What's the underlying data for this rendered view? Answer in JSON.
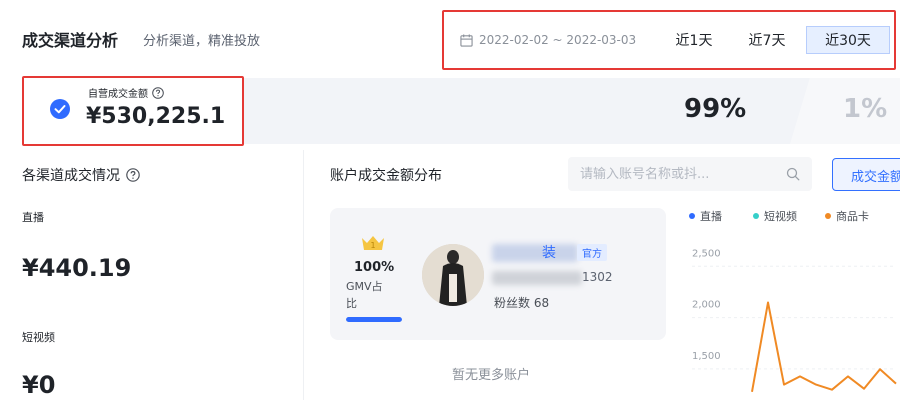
{
  "header": {
    "title": "成交渠道分析",
    "subtitle": "分析渠道，精准投放"
  },
  "date_filter": {
    "range": "2022-02-02 ~ 2022-03-03",
    "tabs": [
      {
        "label": "近1天",
        "selected": false
      },
      {
        "label": "近7天",
        "selected": false
      },
      {
        "label": "近30天",
        "selected": true
      }
    ]
  },
  "summary": {
    "self_label": "自营成交金额",
    "self_value": "¥530,225.1",
    "self_share": "99%",
    "other_share": "1%"
  },
  "channels": {
    "title": "各渠道成交情况",
    "items": [
      {
        "label": "直播",
        "value": "¥440.19"
      },
      {
        "label": "短视频",
        "value": "¥0"
      }
    ]
  },
  "accounts": {
    "title": "账户成交金额分布",
    "search_placeholder": "请输入账号名称或抖...",
    "metric_button": "成交金额",
    "card": {
      "gmv_percent": "100%",
      "gmv_label": "GMV占比",
      "gmv_share": 1.0,
      "name_visible": "装",
      "badge": "官方",
      "id_visible": "1302",
      "fans": "粉丝数 68"
    },
    "no_more": "暂无更多账户"
  },
  "colors": {
    "accent": "#2f6bff",
    "highlight_border": "#e53935",
    "live": "#2f6bff",
    "short_video": "#36cfc9",
    "product_card": "#f08a24"
  },
  "chart_data": {
    "type": "line",
    "legend": [
      "直播",
      "短视频",
      "商品卡"
    ],
    "legend_position": "top",
    "y_ticks": [
      "2,500",
      "2,000",
      "1,500"
    ],
    "ylim": [
      1100,
      2600
    ],
    "grid": true,
    "series": [
      {
        "name": "商品卡",
        "values": [
          1180,
          2050,
          1250,
          1330,
          1250,
          1200,
          1330,
          1210,
          1400,
          1260
        ]
      }
    ]
  }
}
